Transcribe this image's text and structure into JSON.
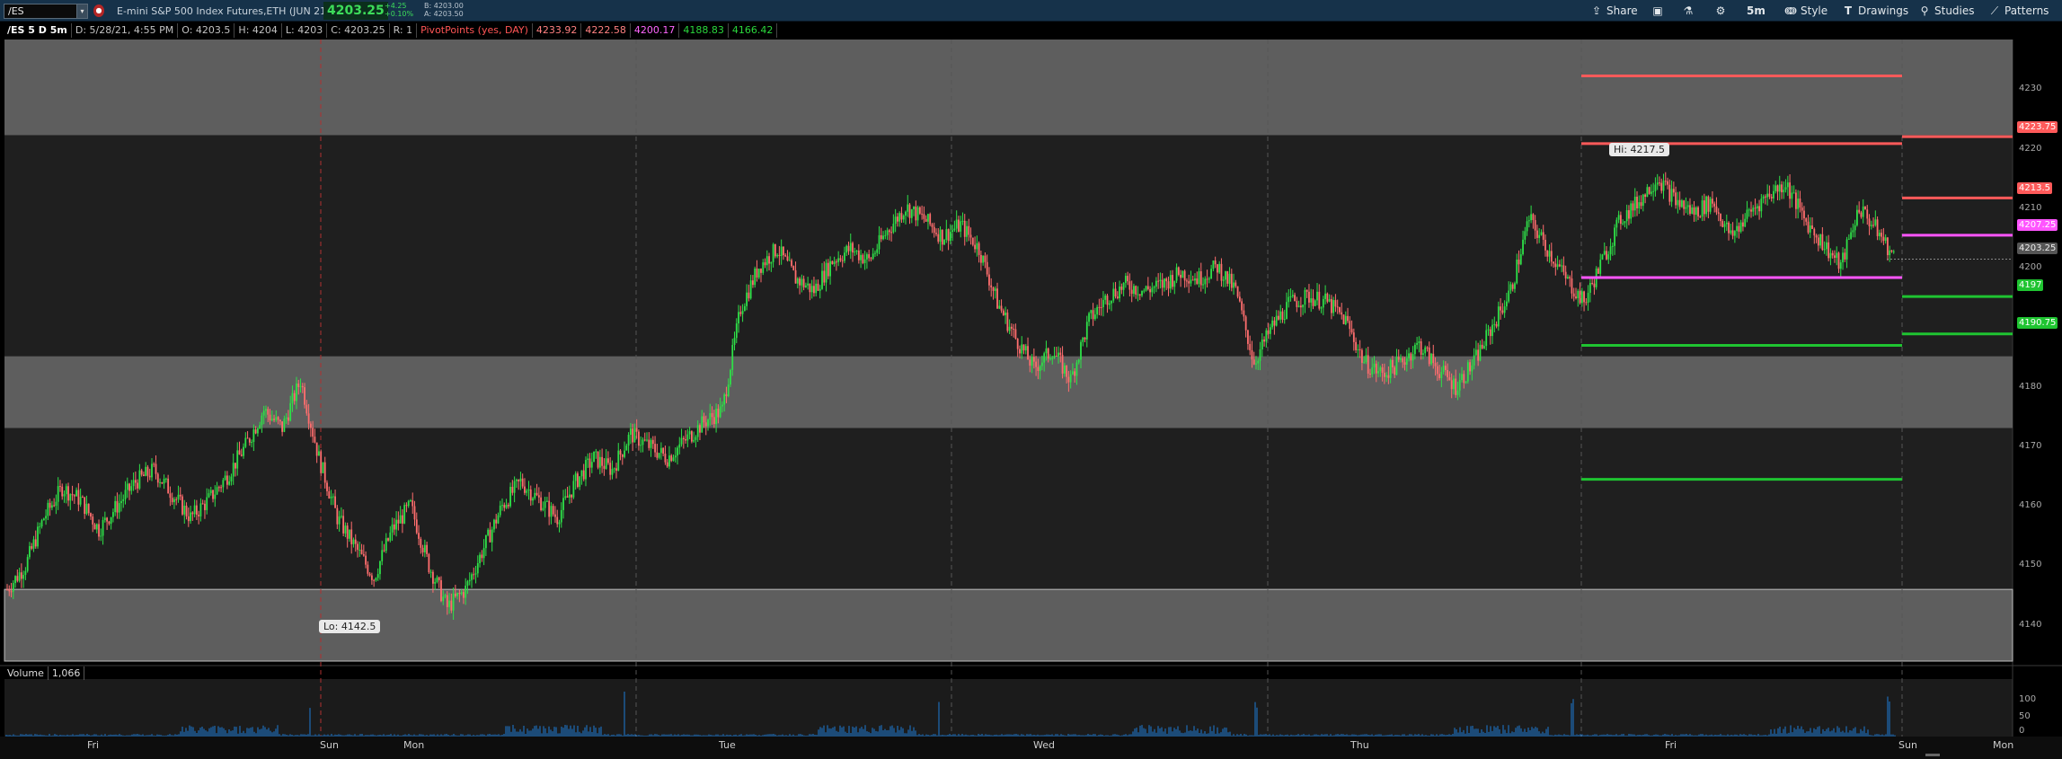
{
  "toolbar": {
    "symbol": "/ES",
    "flag_icon": "record-icon",
    "description": "E-mini S&P 500 Index Futures,ETH (JUN 21)",
    "last_price": "4203.25",
    "change_top": "+4.25",
    "change_bottom": "+0.10%",
    "bid": "B: 4203.00",
    "ask": "A: 4203.50",
    "share_label": "Share",
    "timeframe_label": "5m",
    "style_label": "Style",
    "drawings_label": "Drawings",
    "studies_label": "Studies",
    "patterns_label": "Patterns"
  },
  "legend": {
    "symbol_period": "/ES 5 D 5m",
    "date": "D: 5/28/21, 4:55 PM",
    "open": "O: 4203.5",
    "high": "H: 4204",
    "low": "L: 4203",
    "close": "C: 4203.25",
    "range": "R: 1",
    "study": "PivotPoints (yes, DAY)",
    "r2": "4233.92",
    "r1": "4222.58",
    "pivot": "4200.17",
    "s1": "4188.83",
    "s2": "4166.42"
  },
  "price_axis": {
    "ticks": [
      "4230",
      "4220",
      "4210",
      "4200",
      "4190",
      "4180",
      "4170",
      "4160",
      "4150",
      "4140"
    ],
    "flags": [
      {
        "label": "4223.75",
        "color": "#ff5a5a"
      },
      {
        "label": "4213.5",
        "color": "#ff5a5a"
      },
      {
        "label": "4207.25",
        "color": "#ff55ff"
      },
      {
        "label": "4203.25",
        "color": "#555555"
      },
      {
        "label": "4197",
        "color": "#1fc431"
      },
      {
        "label": "4190.75",
        "color": "#1fc431"
      }
    ]
  },
  "callouts": {
    "high": "Hi: 4217.5",
    "low": "Lo: 4142.5"
  },
  "volume": {
    "title": "Volume",
    "value": "1,066",
    "ticks": [
      "100",
      "50",
      "0"
    ]
  },
  "time_axis": {
    "labels": [
      "Fri",
      "Sun",
      "Mon",
      "Tue",
      "Wed",
      "Thu",
      "Fri",
      "Sun",
      "Mon"
    ]
  },
  "chart_data": {
    "type": "candlestick",
    "instrument": "/ES",
    "interval": "5m",
    "ylim": [
      4136,
      4240
    ],
    "days": [
      "Fri",
      "Sun",
      "Mon",
      "Tue",
      "Wed",
      "Thu",
      "Fri"
    ],
    "price_path": [
      4148,
      4152,
      4160,
      4165,
      4163,
      4158,
      4162,
      4166,
      4168,
      4164,
      4160,
      4163,
      4167,
      4172,
      4178,
      4175,
      4183,
      4170,
      4160,
      4155,
      4150,
      4158,
      4162,
      4152,
      4145,
      4148,
      4155,
      4162,
      4166,
      4163,
      4160,
      4166,
      4170,
      4168,
      4174,
      4172,
      4170,
      4173,
      4176,
      4178,
      4195,
      4202,
      4205,
      4200,
      4198,
      4203,
      4205,
      4203,
      4208,
      4212,
      4210,
      4207,
      4209,
      4205,
      4196,
      4190,
      4185,
      4188,
      4183,
      4193,
      4197,
      4199,
      4198,
      4199,
      4201,
      4200,
      4202,
      4198,
      4186,
      4192,
      4196,
      4197,
      4196,
      4193,
      4186,
      4184,
      4186,
      4189,
      4185,
      4182,
      4186,
      4192,
      4198,
      4210,
      4205,
      4200,
      4196,
      4203,
      4210,
      4213,
      4217,
      4213,
      4211,
      4213,
      4207,
      4211,
      4214,
      4216,
      4210,
      4206,
      4202,
      4212,
      4208,
      4203
    ],
    "pivot_levels": [
      {
        "name": "R2",
        "value": 4233.92
      },
      {
        "name": "R1",
        "value": 4222.58
      },
      {
        "name": "PP",
        "value": 4200.17
      },
      {
        "name": "S1",
        "value": 4188.83
      },
      {
        "name": "S2",
        "value": 4166.42
      }
    ],
    "next_levels": [
      {
        "name": "R1",
        "value": 4223.75
      },
      {
        "name": "R2",
        "value": 4213.5
      },
      {
        "name": "PP",
        "value": 4207.25
      },
      {
        "name": "S1",
        "value": 4197
      },
      {
        "name": "S2",
        "value": 4190.75
      }
    ],
    "zones": [
      [
        4224,
        4240
      ],
      [
        4175,
        4187
      ],
      [
        4136,
        4148
      ]
    ],
    "high": 4217.5,
    "low": 4142.5,
    "last": 4203.25,
    "colors": {
      "up": "#2ee048",
      "down": "#ff6e6e",
      "r": "#ff5a5a",
      "pivot": "#ff55ff",
      "s": "#1fc431"
    }
  }
}
